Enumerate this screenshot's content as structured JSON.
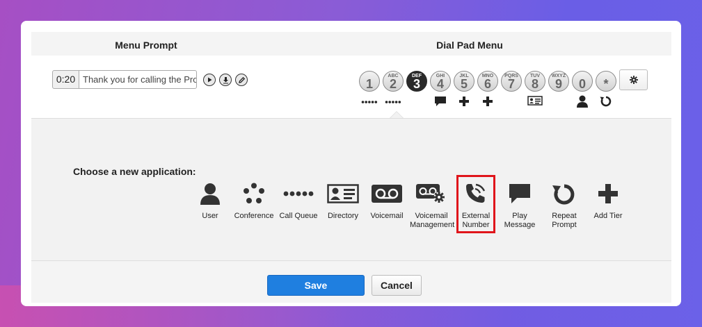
{
  "header": {
    "menu_prompt": "Menu Prompt",
    "dial_pad_menu": "Dial Pad Menu"
  },
  "prompt": {
    "time": "0:20",
    "text": "Thank you for calling the Pro"
  },
  "keys": [
    {
      "digit": "1",
      "letters": ""
    },
    {
      "digit": "2",
      "letters": "ABC"
    },
    {
      "digit": "3",
      "letters": "DEF",
      "selected": true
    },
    {
      "digit": "4",
      "letters": "GHI"
    },
    {
      "digit": "5",
      "letters": "JKL"
    },
    {
      "digit": "6",
      "letters": "MNO"
    },
    {
      "digit": "7",
      "letters": "PQRS"
    },
    {
      "digit": "8",
      "letters": "TUV"
    },
    {
      "digit": "9",
      "letters": "WXYZ"
    },
    {
      "digit": "0",
      "letters": ""
    },
    {
      "digit": "*",
      "letters": ""
    }
  ],
  "key_actions": [
    {
      "key": "1",
      "icon": "call-queue-icon"
    },
    {
      "key": "2",
      "icon": "call-queue-icon"
    },
    {
      "key": "4",
      "icon": "play-message-icon"
    },
    {
      "key": "5",
      "icon": "add-tier-icon"
    },
    {
      "key": "6",
      "icon": "add-tier-icon"
    },
    {
      "key": "8",
      "icon": "directory-icon"
    },
    {
      "key": "0",
      "icon": "user-icon"
    },
    {
      "key": "*",
      "icon": "repeat-prompt-icon"
    }
  ],
  "panel": {
    "choose_label": "Choose a new application:",
    "apps": [
      {
        "label": "User",
        "icon": "user-icon"
      },
      {
        "label": "Conference",
        "icon": "conference-icon"
      },
      {
        "label": "Call Queue",
        "icon": "call-queue-icon"
      },
      {
        "label": "Directory",
        "icon": "directory-icon"
      },
      {
        "label": "Voicemail",
        "icon": "voicemail-icon"
      },
      {
        "label": "Voicemail Management",
        "icon": "voicemail-management-icon"
      },
      {
        "label": "External Number",
        "icon": "external-number-icon",
        "highlighted": true
      },
      {
        "label": "Play Message",
        "icon": "play-message-icon"
      },
      {
        "label": "Repeat Prompt",
        "icon": "repeat-prompt-icon"
      },
      {
        "label": "Add Tier",
        "icon": "add-tier-icon"
      }
    ]
  },
  "footer": {
    "save_label": "Save",
    "cancel_label": "Cancel"
  },
  "colors": {
    "primary": "#1f7fe0",
    "highlight": "#e0151b",
    "selected_key": "#2a2a2a"
  }
}
